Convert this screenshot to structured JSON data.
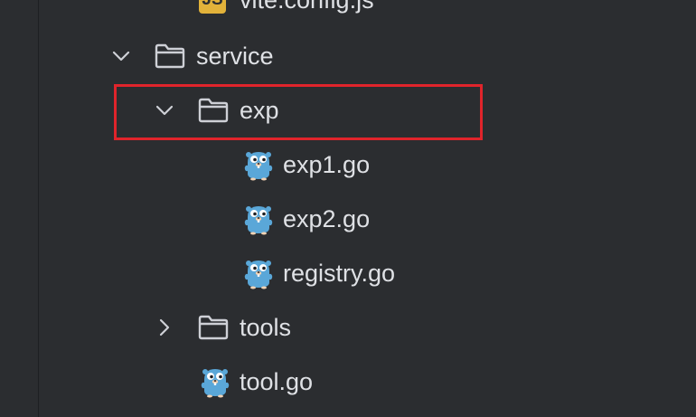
{
  "tree": {
    "vite_config": {
      "label": "vite.config.js",
      "icon": "js-file-icon",
      "icon_text": "JS"
    },
    "service": {
      "label": "service",
      "icon": "folder-icon",
      "expanded": true
    },
    "exp": {
      "label": "exp",
      "icon": "folder-icon",
      "expanded": true,
      "highlighted": true
    },
    "exp1": {
      "label": "exp1.go",
      "icon": "go-gopher-icon"
    },
    "exp2": {
      "label": "exp2.go",
      "icon": "go-gopher-icon"
    },
    "registry": {
      "label": "registry.go",
      "icon": "go-gopher-icon"
    },
    "tools": {
      "label": "tools",
      "icon": "folder-icon",
      "expanded": false
    },
    "tool": {
      "label": "tool.go",
      "icon": "go-gopher-icon"
    }
  },
  "colors": {
    "background": "#2b2d30",
    "text": "#dfe1e5",
    "icon_stroke": "#ced0d6",
    "highlight_border": "#e0242b",
    "js_badge": "#e2b23a",
    "gopher_blue": "#5aa7d8"
  }
}
